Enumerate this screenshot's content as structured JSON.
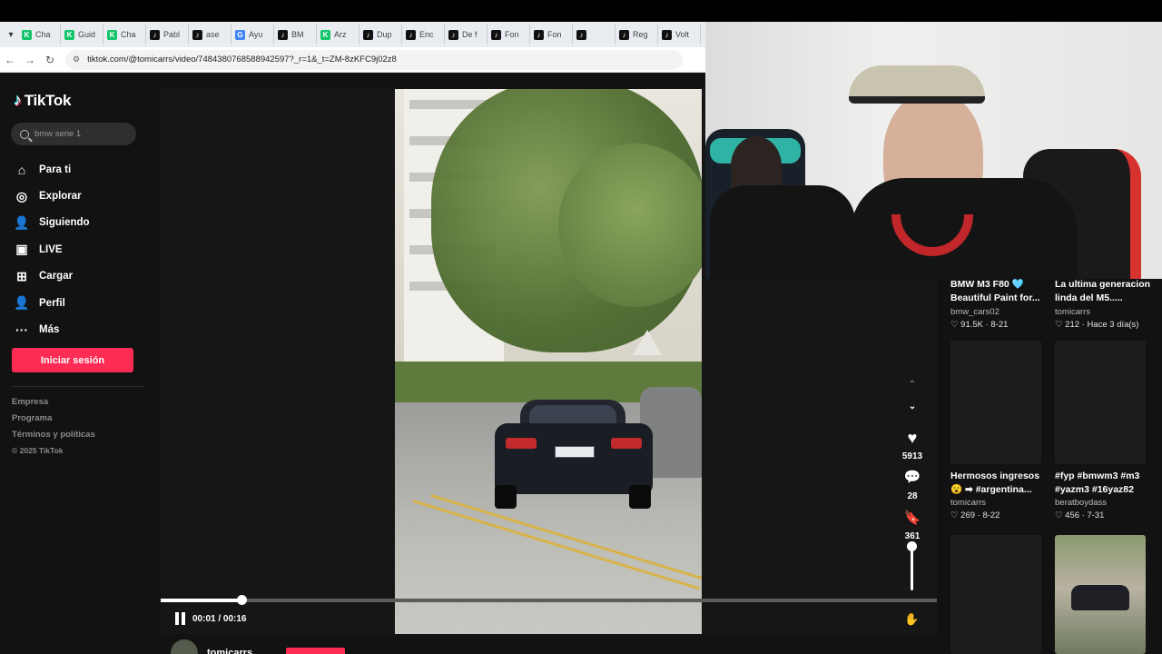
{
  "browser": {
    "tabs": [
      {
        "label": "Cha",
        "icon": "tiktok-green-icon",
        "color": "#12c56a"
      },
      {
        "label": "Guid",
        "icon": "tiktok-green-icon",
        "color": "#12c56a"
      },
      {
        "label": "Cha",
        "icon": "tiktok-green-icon",
        "color": "#12c56a"
      },
      {
        "label": "Pabl",
        "icon": "tiktok-icon",
        "color": "#111111"
      },
      {
        "label": "ase",
        "icon": "tiktok-icon",
        "color": "#111111"
      },
      {
        "label": "Ayu",
        "icon": "google-icon",
        "color": "#4285f4"
      },
      {
        "label": "BM",
        "icon": "tiktok-icon",
        "color": "#111111"
      },
      {
        "label": "Arz",
        "icon": "tiktok-green-icon",
        "color": "#12c56a"
      },
      {
        "label": "Dup",
        "icon": "tiktok-icon",
        "color": "#111111"
      },
      {
        "label": "Enc",
        "icon": "tiktok-icon",
        "color": "#111111"
      },
      {
        "label": "De f",
        "icon": "tiktok-icon",
        "color": "#111111"
      },
      {
        "label": "Fon",
        "icon": "tiktok-icon",
        "color": "#111111"
      },
      {
        "label": "Fon",
        "icon": "tiktok-icon",
        "color": "#111111"
      },
      {
        "label": "",
        "icon": "tiktok-icon",
        "color": "#111111"
      },
      {
        "label": "Reg",
        "icon": "tiktok-icon",
        "color": "#111111"
      },
      {
        "label": "Volt",
        "icon": "tiktok-icon",
        "color": "#111111"
      }
    ],
    "url": "tiktok.com/@tomicarrs/video/7484380768588942597?_r=1&_t=ZM-8zKFC9j02z8"
  },
  "sidebar": {
    "logo": "TikTok",
    "search_placeholder": "bmw serie 1",
    "menu": [
      {
        "label": "Para ti",
        "icon": "home-icon",
        "glyph": "⌂"
      },
      {
        "label": "Explorar",
        "icon": "compass-icon",
        "glyph": "◎"
      },
      {
        "label": "Siguiendo",
        "icon": "following-icon",
        "glyph": "👤"
      },
      {
        "label": "LIVE",
        "icon": "live-icon",
        "glyph": "▣"
      },
      {
        "label": "Cargar",
        "icon": "upload-icon",
        "glyph": "⊞"
      },
      {
        "label": "Perfil",
        "icon": "profile-icon",
        "glyph": "👤"
      },
      {
        "label": "Más",
        "icon": "more-icon",
        "glyph": "···"
      }
    ],
    "login_label": "Iniciar sesión",
    "footer": [
      "Empresa",
      "Programa",
      "Términos y políticas"
    ],
    "copyright": "© 2025 TikTok"
  },
  "video": {
    "likes": "5913",
    "comments": "28",
    "saves": "361",
    "time": "00:01 / 00:16",
    "progress": 0.104,
    "volume": 0.95,
    "author": "tomicarrs"
  },
  "recommendations": [
    {
      "title": "BMW M3 F80 🩵 Beautiful Paint for...",
      "user": "bmw_cars02",
      "stats": "♡ 91.5K · 8-21"
    },
    {
      "title": "La ultima generacion linda del M5.....",
      "user": "tomicarrs",
      "stats": "♡ 212 · Hace 3 día(s)"
    },
    {
      "title": "Hermosos ingresos 😮 ➡ #argentina...",
      "user": "tomicarrs",
      "stats": "♡ 269 · 8-22"
    },
    {
      "title": "#fyp #bmwm3 #m3 #yazm3 #16yaz82",
      "user": "beratboydass",
      "stats": "♡ 456 · 7-31"
    }
  ],
  "colors": {
    "accent": "#fe2c55",
    "bg": "#121212"
  }
}
